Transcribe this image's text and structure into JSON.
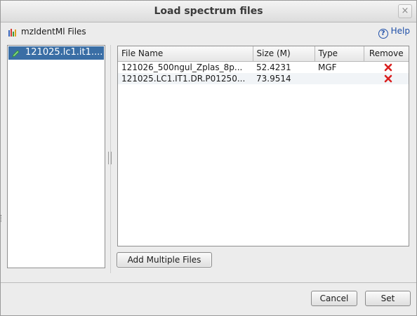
{
  "window": {
    "title": "Load spectrum files",
    "close_glyph": "×"
  },
  "header": {
    "files_label": "mzIdentMl Files",
    "help_label": "Help",
    "help_glyph": "?"
  },
  "left_list": {
    "items": [
      {
        "label": "121025.lc1.it1...."
      }
    ]
  },
  "table": {
    "columns": [
      "File Name",
      "Size (M)",
      "Type",
      "Remove"
    ],
    "rows": [
      {
        "file_name": "121026_500ngul_Zplas_8p...",
        "size": "52.4231",
        "type": "MGF"
      },
      {
        "file_name": "121025.LC1.IT1.DR.P01250...",
        "size": "73.9514",
        "type": ""
      }
    ]
  },
  "buttons": {
    "add_multiple": "Add Multiple Files",
    "cancel": "Cancel",
    "set": "Set"
  },
  "icons": {
    "files_icon": "bar-chart-icon",
    "leaf_icon": "pencil-icon",
    "remove_icon": "red-x-icon"
  },
  "colors": {
    "selection": "#3a6ea5",
    "help_link": "#1f4fa8",
    "remove_red": "#d9201f"
  }
}
